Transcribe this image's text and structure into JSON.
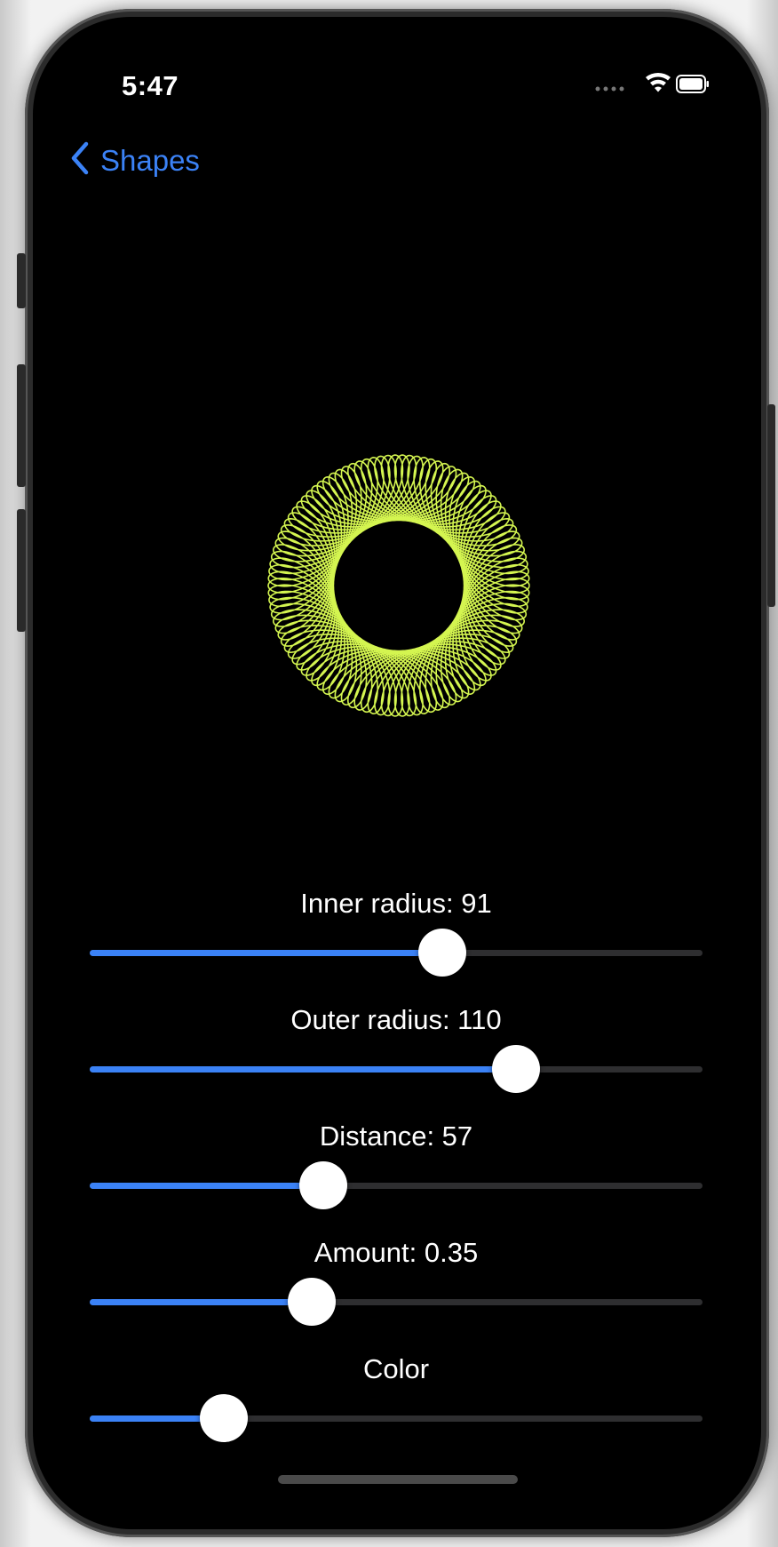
{
  "status_bar": {
    "time": "5:47",
    "signal_icon": "signal-dots-icon",
    "wifi_icon": "wifi-icon",
    "battery_icon": "battery-icon"
  },
  "nav": {
    "back_label": "Shapes",
    "back_icon": "chevron-left-icon"
  },
  "colors": {
    "accent": "#3b82f6",
    "shape_stroke": "#d4f550",
    "background": "#000000",
    "track": "#2e2e30"
  },
  "spirograph": {
    "inner_radius": 91,
    "outer_radius": 110,
    "distance": 57,
    "amount": 0.35
  },
  "controls": [
    {
      "label": "Inner radius: 91",
      "fraction": 0.575
    },
    {
      "label": "Outer radius: 110",
      "fraction": 0.695
    },
    {
      "label": "Distance: 57",
      "fraction": 0.381
    },
    {
      "label": "Amount: 0.35",
      "fraction": 0.363
    },
    {
      "label": "Color",
      "fraction": 0.219
    }
  ]
}
